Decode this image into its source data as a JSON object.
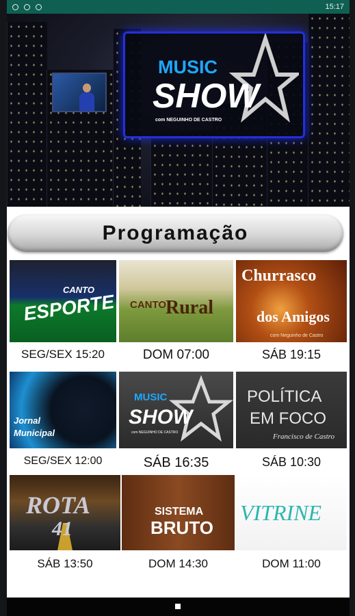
{
  "status_bar": {
    "time": "15:17",
    "icons": [
      "notification-icon",
      "notification-icon",
      "notification-icon"
    ]
  },
  "hero": {
    "logo_line1": "MUSIC",
    "logo_line2": "SHOW",
    "logo_credit": "com NEGUINHO DE CASTRO"
  },
  "programacao": {
    "title": "Programação"
  },
  "programs": [
    {
      "thumb_text_1": "CANTO",
      "thumb_text_2": "ESPORTE",
      "time": "SEG/SEX 15:20"
    },
    {
      "thumb_text_1": "CANTO",
      "thumb_text_2": "Rural",
      "time": "DOM 07:00"
    },
    {
      "thumb_text_1": "Churrasco",
      "thumb_text_2": "dos Amigos",
      "thumb_text_3": "com Neguinho de Castro",
      "time": "SÁB 19:15"
    },
    {
      "thumb_text_1": "Jornal",
      "thumb_text_2": "Municipal",
      "time": "SEG/SEX 12:00"
    },
    {
      "thumb_text_1": "MUSIC",
      "thumb_text_2": "SHOW",
      "thumb_text_3": "com NEGUINHO DE CASTRO",
      "time": "SÁB 16:35"
    },
    {
      "thumb_text_1": "POLÍTICA",
      "thumb_text_2": "EM FOCO",
      "thumb_text_3": "Francisco de Castro",
      "time": "SÁB 10:30"
    },
    {
      "thumb_text_1": "ROTA",
      "thumb_text_2": "41",
      "time": "SÁB 13:50"
    },
    {
      "thumb_text_1": "SISTEMA",
      "thumb_text_2": "BRUTO",
      "time": "DOM 14:30"
    },
    {
      "thumb_text_1": "VITRINE",
      "time": "DOM 11:00"
    }
  ],
  "colors": {
    "status_bar": "#0f5f52",
    "logo_border": "#2430d8",
    "logo_blue": "#1ea8ff"
  }
}
